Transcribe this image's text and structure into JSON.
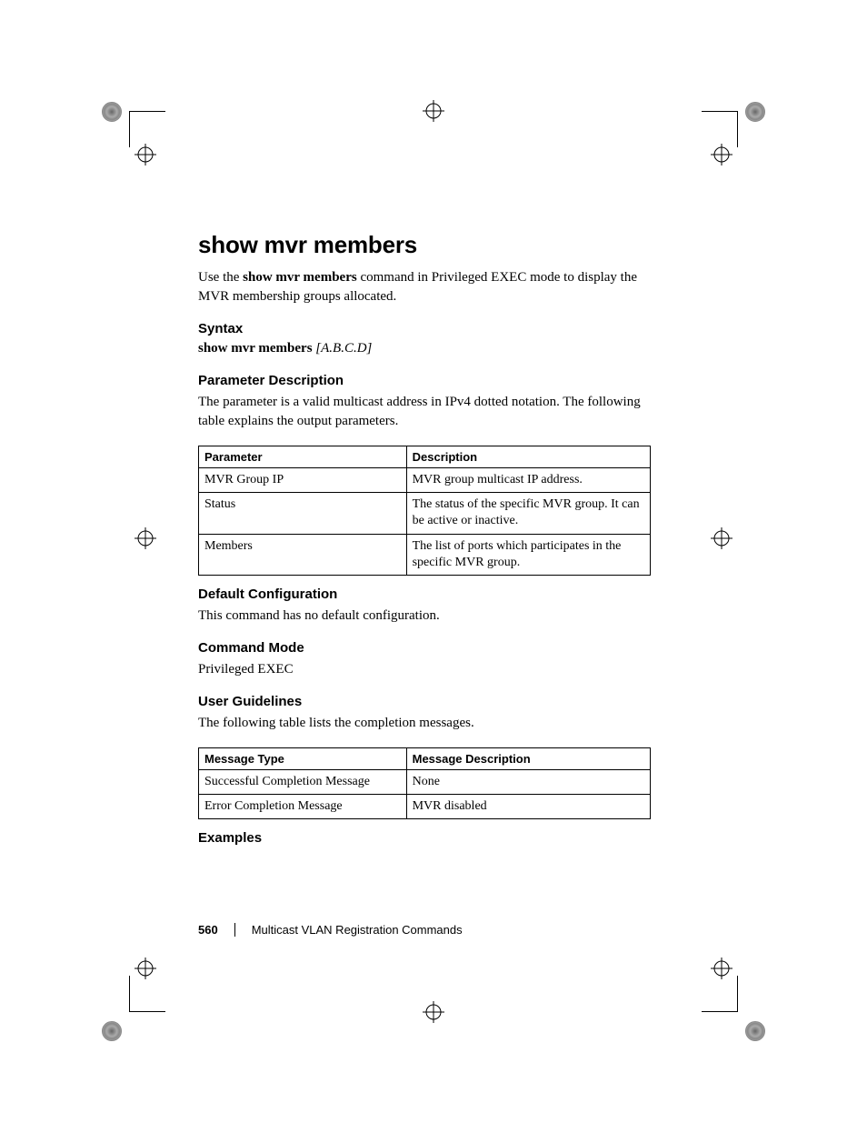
{
  "title": "show mvr members",
  "intro_prefix": "Use the ",
  "intro_cmd": "show mvr members",
  "intro_suffix": " command in Privileged EXEC mode to display the MVR membership groups allocated.",
  "sections": {
    "syntax_head": "Syntax",
    "syntax_cmd": "show mvr members",
    "syntax_arg": " [A.B.C.D]",
    "param_head": "Parameter Description",
    "param_intro": "The parameter is a valid multicast address in IPv4 dotted notation. The following table explains the output parameters.",
    "default_head": "Default Configuration",
    "default_body": "This command has no default configuration.",
    "mode_head": "Command Mode",
    "mode_body": "Privileged EXEC",
    "guide_head": "User Guidelines",
    "guide_body": "The following table lists the completion messages.",
    "examples_head": "Examples"
  },
  "param_table": {
    "col0": "Parameter",
    "col1": "Description",
    "rows": [
      {
        "p": "MVR Group IP",
        "d": "MVR group multicast IP address."
      },
      {
        "p": "Status",
        "d": "The status of the specific MVR group. It can be active or inactive."
      },
      {
        "p": "Members",
        "d": "The list of ports which participates in the specific MVR group."
      }
    ]
  },
  "msg_table": {
    "col0": "Message Type",
    "col1": "Message Description",
    "rows": [
      {
        "t": "Successful Completion Message",
        "d": "None"
      },
      {
        "t": "Error Completion Message",
        "d": "MVR disabled"
      }
    ]
  },
  "footer": {
    "page": "560",
    "chapter": "Multicast VLAN Registration Commands"
  }
}
